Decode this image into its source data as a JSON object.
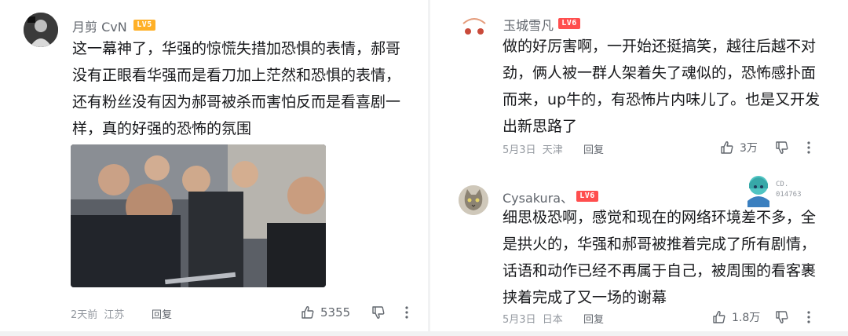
{
  "comments": [
    {
      "username": "月剪 CvN",
      "level": "LV5",
      "text": "这一幕神了，华强的惊慌失措加恐惧的表情，郝哥没有正眼看华强而是看刀加上茫然和恐惧的表情，还有粉丝没有因为郝哥被杀而害怕反而是看喜剧一样，真的好强的恐怖的氛围",
      "time": "2天前",
      "location": "江苏",
      "reply_label": "回复",
      "likes": "5355"
    },
    {
      "username": "玉城雪凡",
      "level": "LV6",
      "text": "做的好厉害啊，一开始还挺搞笑，越往后越不对劲，俩人被一群人架着失了魂似的，恐怖感扑面而来，up牛的，有恐怖片内味儿了。也是又开发出新思路了",
      "time": "5月3日",
      "location": "天津",
      "reply_label": "回复",
      "likes": "3万"
    },
    {
      "username": "Cysakura、",
      "level": "LV6",
      "text": "细思极恐啊，感觉和现在的网络环境差不多，全是拱火的，华强和郝哥被推着完成了所有剧情，话语和动作已经不再属于自己，被周围的看客裹挟着完成了又一场的谢幕",
      "time": "5月3日",
      "location": "日本",
      "reply_label": "回复",
      "likes": "1.8万",
      "badge_text": "CD.",
      "badge_number": "014763"
    }
  ],
  "colors": {
    "lv5": "#ffb027",
    "lv6": "#ff4e4e",
    "meta": "#9499a0",
    "text": "#18191c"
  }
}
